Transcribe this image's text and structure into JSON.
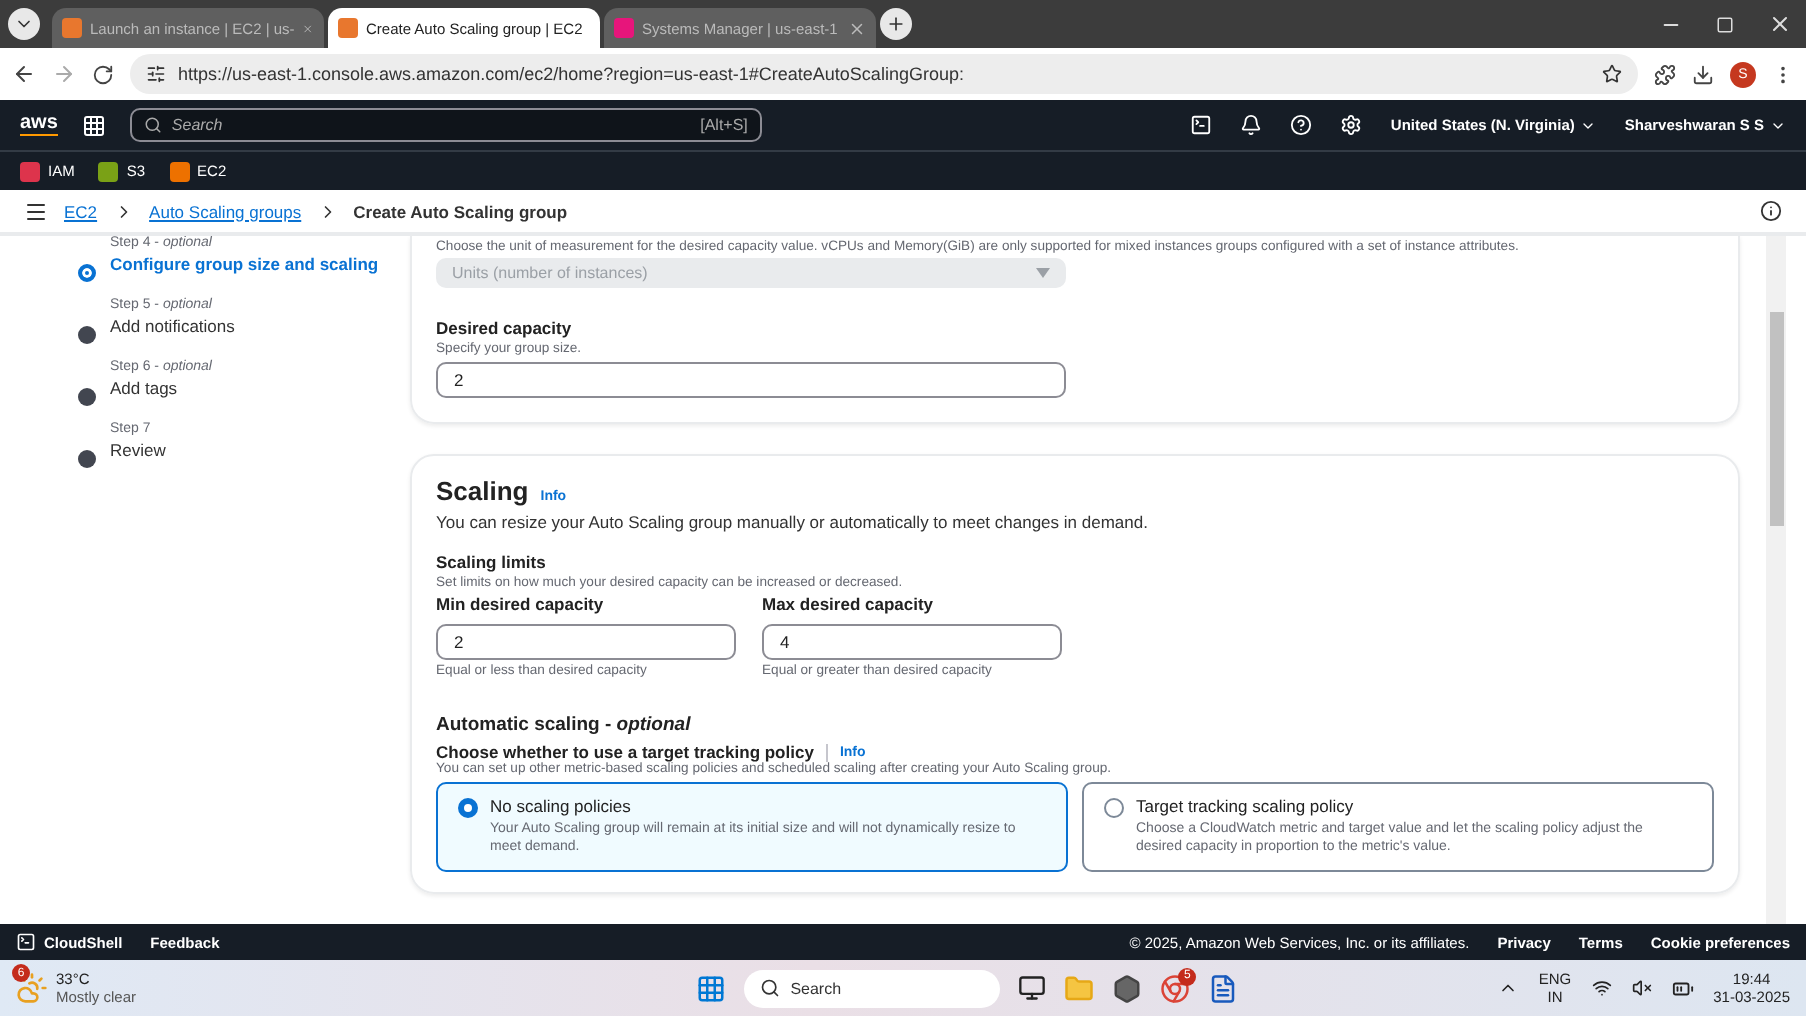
{
  "browser": {
    "tabs": [
      {
        "title": "Launch an instance | EC2 | us-",
        "selected": false,
        "color": "#e8772e"
      },
      {
        "title": "Create Auto Scaling group | EC2",
        "selected": true,
        "color": "#e8772e"
      },
      {
        "title": "Systems Manager | us-east-1",
        "selected": false,
        "color": "#e7157b"
      }
    ],
    "url": "https://us-east-1.console.aws.amazon.com/ec2/home?region=us-east-1#CreateAutoScalingGroup:",
    "profile": "S"
  },
  "console_header": {
    "logo": "aws",
    "search_placeholder": "Search",
    "shortcut": "[Alt+S]",
    "region": "United States (N. Virginia)",
    "user": "Sharveshwaran S S"
  },
  "favorites": [
    {
      "label": "IAM",
      "color": "#dd344c"
    },
    {
      "label": "S3",
      "color": "#7aa116"
    },
    {
      "label": "EC2",
      "color": "#ed7100"
    }
  ],
  "breadcrumb": [
    {
      "label": "EC2",
      "current": false
    },
    {
      "label": "Auto Scaling groups",
      "current": false
    },
    {
      "label": "Create Auto Scaling group",
      "current": true
    }
  ],
  "steps": [
    {
      "step": "Step 4 - *optional*",
      "title": "Configure group size and scaling",
      "selected": true
    },
    {
      "step": "Step 5 - *optional*",
      "title": "Add notifications",
      "selected": false
    },
    {
      "step": "Step 6 - *optional*",
      "title": "Add tags",
      "selected": false
    },
    {
      "step": "Step 7",
      "title": "Review",
      "selected": false
    }
  ],
  "capacity": {
    "unit_hint": "Choose the unit of measurement for the desired capacity value. vCPUs and Memory(GiB) are only supported for mixed instances groups configured with a set of instance attributes.",
    "unit_select": {
      "value": "Units (number of instances)",
      "disabled": true
    },
    "desired_label": "Desired capacity",
    "desired_hint": "Specify your group size.",
    "desired_value": "2"
  },
  "scaling": {
    "title": "Scaling",
    "info": "Info",
    "description": "You can resize your Auto Scaling group manually or automatically to meet changes in demand.",
    "limits_title": "Scaling limits",
    "limits_hint": "Set limits on how much your desired capacity can be increased or decreased.",
    "fields": [
      {
        "label": "Min desired capacity",
        "value": "2",
        "hint": "Equal or less than desired capacity"
      },
      {
        "label": "Max desired capacity",
        "value": "4",
        "hint": "Equal or greater than desired capacity"
      }
    ],
    "auto_title": "Automatic scaling - *optional*",
    "policy_label": "Choose whether to use a target tracking policy",
    "policy_info": "Info",
    "policy_hint": "You can set up other metric-based scaling policies and scheduled scaling after creating your Auto Scaling group.",
    "options": [
      {
        "title": "No scaling policies",
        "description": "Your Auto Scaling group will remain at its initial size and will not dynamically resize to meet demand.",
        "selected": true
      },
      {
        "title": "Target tracking scaling policy",
        "description": "Choose a CloudWatch metric and target value and let the scaling policy adjust the desired capacity in proportion to the metric's value.",
        "selected": false
      }
    ]
  },
  "footer": {
    "cloudshell": "CloudShell",
    "feedback": "Feedback",
    "copyright": "© 2025, Amazon Web Services, Inc. or its affiliates.",
    "links": [
      "Privacy",
      "Terms",
      "Cookie preferences"
    ]
  },
  "taskbar": {
    "temperature": "33°C",
    "condition": "Mostly clear",
    "weather_badge": "6",
    "search_placeholder": "Search",
    "browser_badge": "5",
    "language": "ENG",
    "region": "IN",
    "time": "19:44",
    "date": "31-03-2025"
  }
}
